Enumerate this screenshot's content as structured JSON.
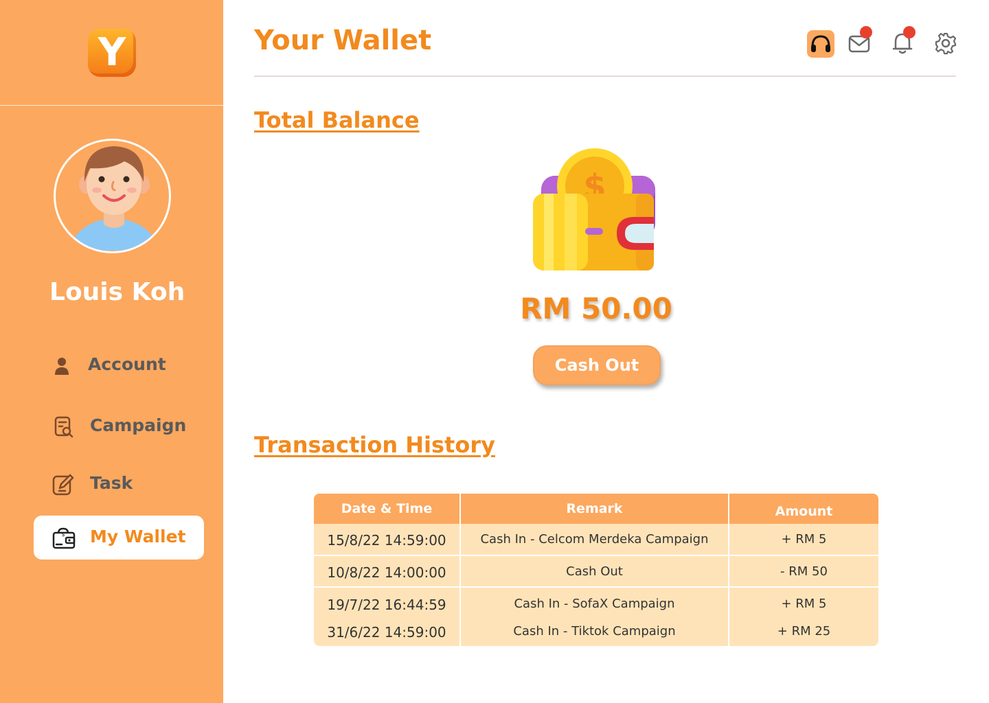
{
  "app": {
    "logo_letter": "Y"
  },
  "sidebar": {
    "user_name": "Louis Koh",
    "items": [
      {
        "label": "Account",
        "icon": "user-icon",
        "active": false
      },
      {
        "label": "Campaign",
        "icon": "campaign-search-icon",
        "active": false
      },
      {
        "label": "Task",
        "icon": "edit-task-icon",
        "active": false
      },
      {
        "label": "My Wallet",
        "icon": "wallet-icon",
        "active": true
      }
    ]
  },
  "header": {
    "title": "Your Wallet",
    "icons": [
      "headset-icon",
      "mail-icon",
      "bell-icon",
      "gear-icon"
    ]
  },
  "balance": {
    "section_title": "Total Balance",
    "amount": "RM 50.00",
    "cash_out_label": "Cash Out"
  },
  "transactions": {
    "section_title": "Transaction History",
    "columns": [
      "Date & Time",
      "Remark",
      "Amount"
    ],
    "rows": [
      {
        "date": "15/8/22 14:59:00",
        "remark": "Cash In - Celcom Merdeka Campaign",
        "amount": "+ RM 5"
      },
      {
        "date": "10/8/22 14:00:00",
        "remark": "Cash Out",
        "amount": "- RM 50"
      },
      {
        "date": "19/7/22 16:44:59",
        "remark": "Cash In - SofaX Campaign",
        "amount": "+ RM 5"
      },
      {
        "date": "31/6/22 14:59:00",
        "remark": "Cash In - Tiktok Campaign",
        "amount": "+ RM 25"
      }
    ]
  },
  "colors": {
    "sidebar_bg": "#FCA85F",
    "accent": "#F28A1E",
    "table_row_bg": "#FFE3B8",
    "notification_dot": "#E8402F"
  }
}
